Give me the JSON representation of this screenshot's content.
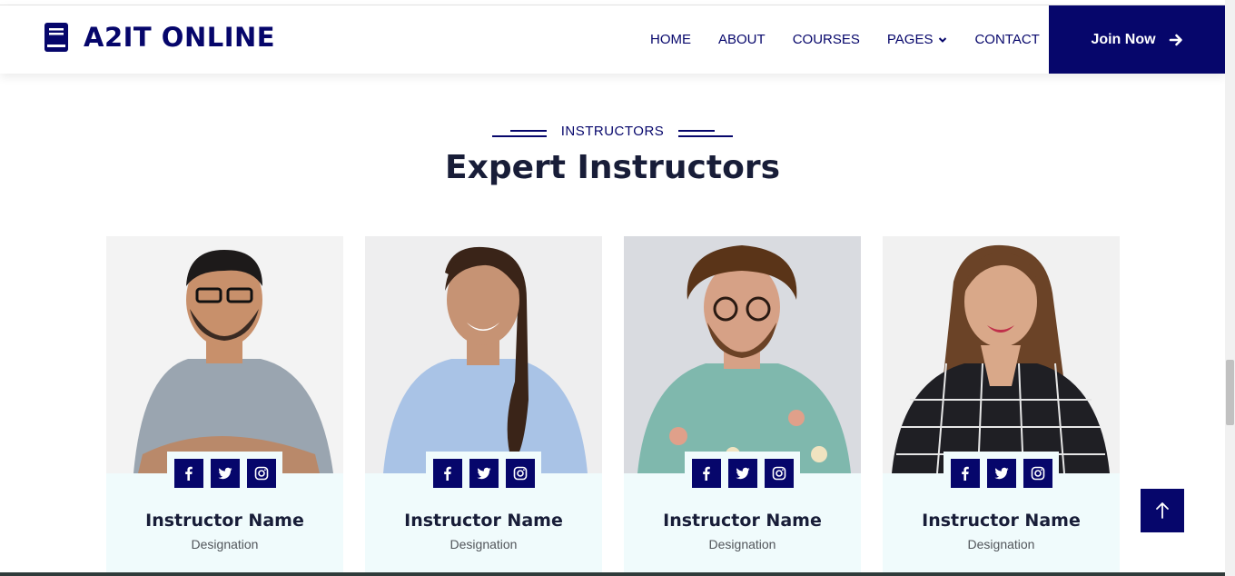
{
  "brand": {
    "name": "A2IT ONLINE",
    "icon": "book-icon"
  },
  "nav": {
    "items": [
      {
        "label": "HOME",
        "active": true
      },
      {
        "label": "ABOUT"
      },
      {
        "label": "COURSES"
      },
      {
        "label": "PAGES",
        "dropdown": true
      },
      {
        "label": "CONTACT"
      }
    ],
    "join_label": "Join Now"
  },
  "section": {
    "tag": "INSTRUCTORS",
    "title": "Expert Instructors"
  },
  "instructors": [
    {
      "name": "Instructor Name",
      "designation": "Designation"
    },
    {
      "name": "Instructor Name",
      "designation": "Designation"
    },
    {
      "name": "Instructor Name",
      "designation": "Designation"
    },
    {
      "name": "Instructor Name",
      "designation": "Designation"
    }
  ],
  "socials": [
    "facebook-icon",
    "twitter-icon",
    "instagram-icon"
  ],
  "colors": {
    "primary": "#06066b",
    "card_bg": "#f0fbfc",
    "heading": "#181d38"
  }
}
